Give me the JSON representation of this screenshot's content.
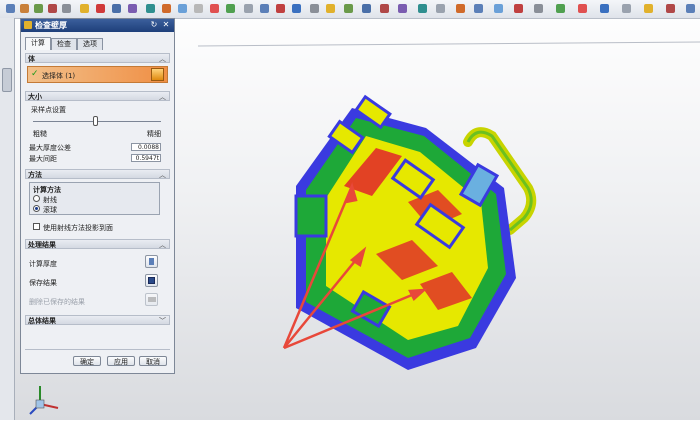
{
  "dialog": {
    "title": "检查壁厚",
    "tabs": [
      "计算",
      "检查",
      "选项"
    ],
    "body": {
      "header": "体",
      "select_label": "选择体 (1)"
    },
    "size": {
      "header": "大小",
      "sample_label": "采样点设置",
      "coarse_label": "粗糙",
      "fine_label": "精细",
      "slider_level": 0.5,
      "max_thickness_tol_label": "最大厚度公差",
      "max_thickness_tol_value": "0.0088",
      "max_spacing_label": "最大间距",
      "max_spacing_value": "0.5947t"
    },
    "method": {
      "header": "方法",
      "group_label": "计算方法",
      "option_ray": "射线",
      "option_sphere": "滚球",
      "selected": "滚球",
      "checkbox_label": "使用射线方法投影到面"
    },
    "results": {
      "header": "处理结果",
      "compute_label": "计算厚度",
      "save_label": "保存结果",
      "delete_label": "删除已保存的结果"
    },
    "summary": {
      "header": "总体结果"
    },
    "buttons": {
      "ok": "确定",
      "apply": "应用",
      "cancel": "取消"
    }
  },
  "colors": {
    "titlebar": "#1e3f7a",
    "arrow": "#e8483a",
    "model_yellow": "#e6e800",
    "model_red": "#e0252a",
    "model_blue": "#3a3ae0"
  }
}
